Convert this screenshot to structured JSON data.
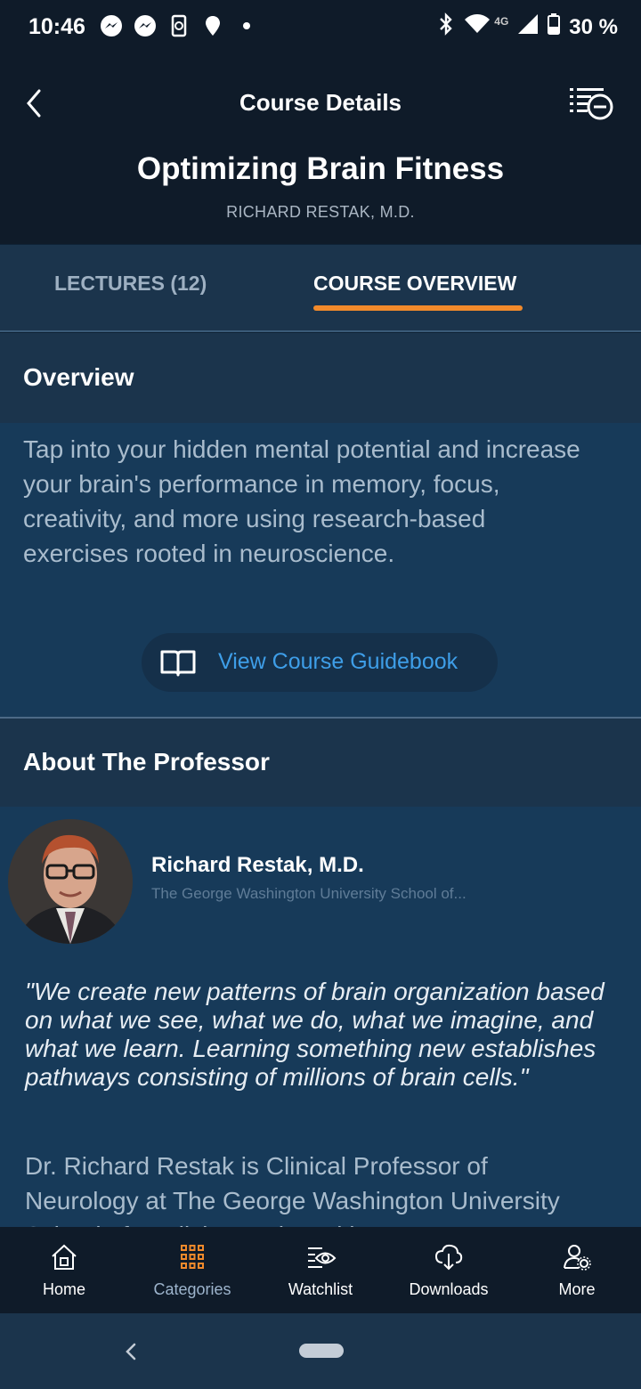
{
  "status_bar": {
    "time": "10:46",
    "network": "4G",
    "battery": "30 %"
  },
  "header": {
    "title": "Course Details",
    "course_title": "Optimizing Brain Fitness",
    "author": "RICHARD RESTAK, M.D."
  },
  "tabs": [
    {
      "label": "LECTURES (12)",
      "active": false
    },
    {
      "label": "COURSE OVERVIEW",
      "active": true
    }
  ],
  "overview": {
    "heading": "Overview",
    "text": "Tap into your hidden mental potential and increase your brain's performance in memory, focus, creativity, and more using research-based exercises rooted in neuroscience.",
    "guidebook_label": "View Course Guidebook"
  },
  "professor": {
    "heading": "About The Professor",
    "name": "Richard Restak, M.D.",
    "school": "The George Washington University School of...",
    "quote": "\"We create new patterns of brain organization based on what we see, what we do, what we imagine, and what we learn. Learning something new establishes pathways consisting of millions of brain cells.\"",
    "bio": "Dr. Richard Restak is Clinical Professor of Neurology at The George Washington University School of Medicine and Health"
  },
  "bottom_nav": [
    {
      "label": "Home",
      "icon": "home-icon",
      "active": false
    },
    {
      "label": "Categories",
      "icon": "grid-icon",
      "active": true
    },
    {
      "label": "Watchlist",
      "icon": "watchlist-icon",
      "active": false
    },
    {
      "label": "Downloads",
      "icon": "download-cloud-icon",
      "active": false
    },
    {
      "label": "More",
      "icon": "user-settings-icon",
      "active": false
    }
  ],
  "colors": {
    "accent": "#f28a2b",
    "link": "#3e9ee8",
    "header_bg": "#0f1b29",
    "section_bg": "#1b344c",
    "body_bg": "#173a59"
  }
}
